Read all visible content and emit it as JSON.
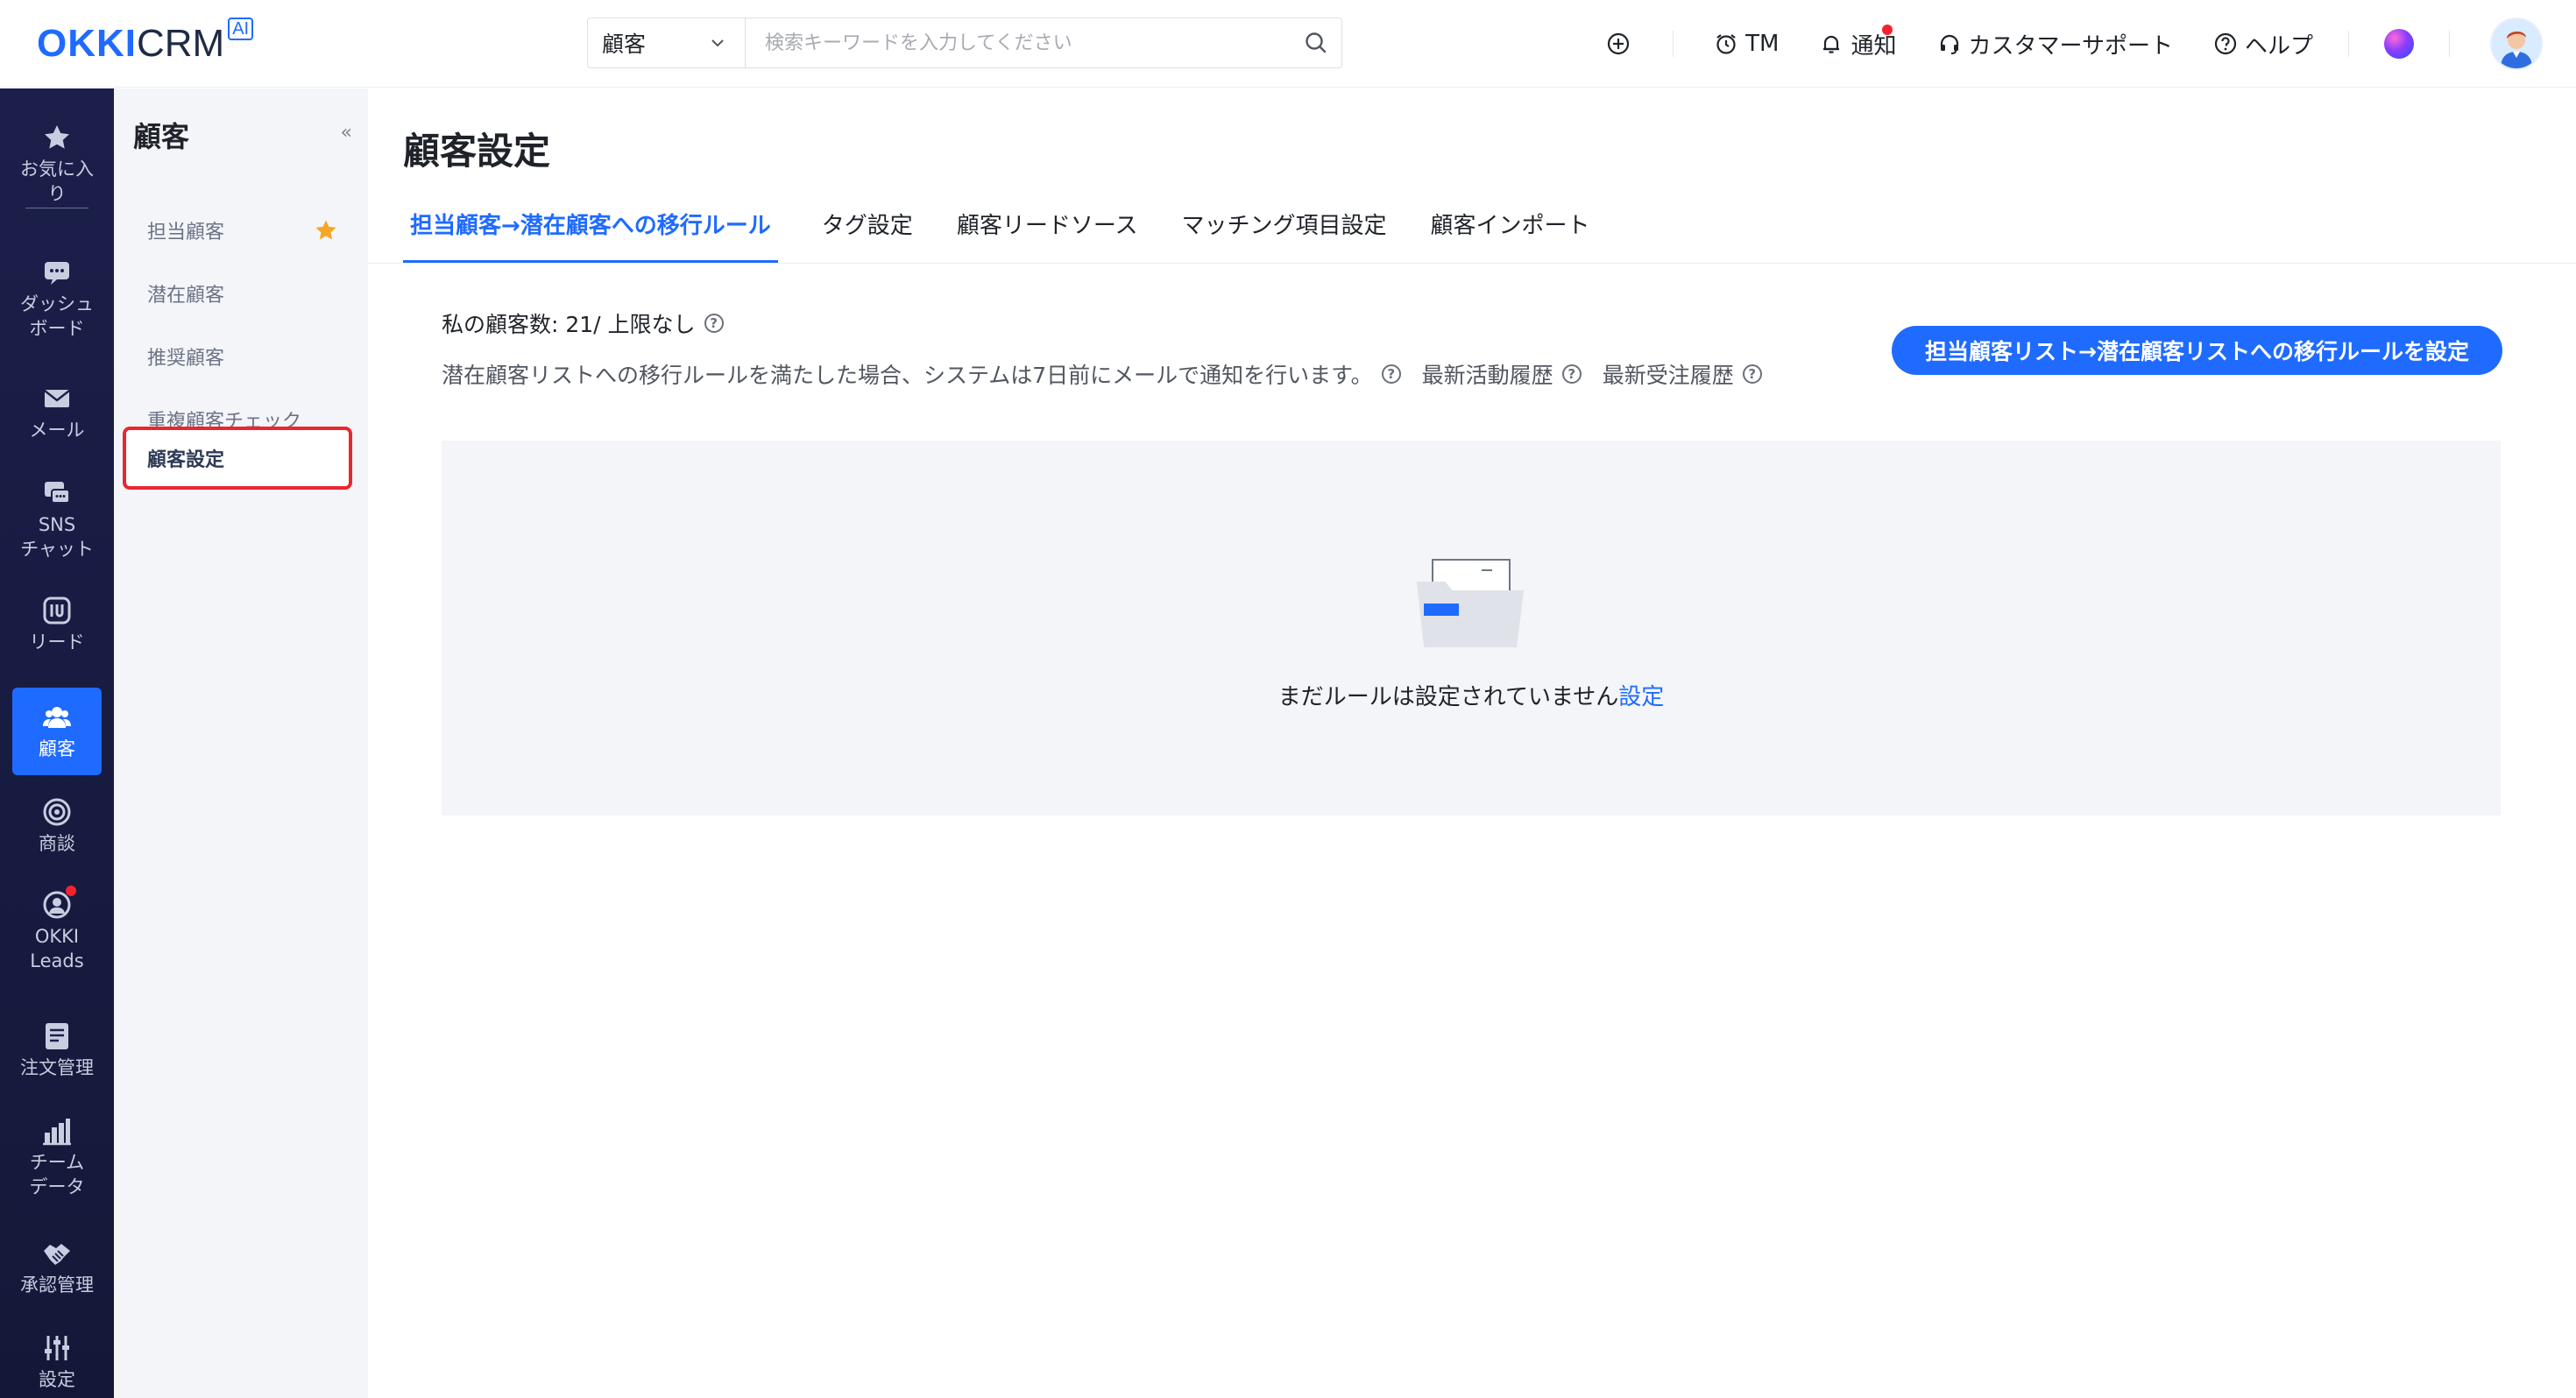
{
  "header": {
    "logo": {
      "brand_bold": "OKKI",
      "brand_light": "CRM",
      "badge": "AI"
    },
    "search": {
      "scope": "顧客",
      "placeholder": "検索キーワードを入力してください",
      "value": ""
    },
    "nav": {
      "tm": "TM",
      "notice": "通知",
      "support": "カスタマーサポート",
      "help": "ヘルプ"
    },
    "colors": {
      "brand": "#1f6bff",
      "alert_dot": "#f5222d"
    }
  },
  "rail": {
    "items": [
      {
        "label": "お気に入り",
        "icon": "star-icon"
      },
      {
        "label": "ダッシュボード",
        "icon": "dashboard-icon"
      },
      {
        "label": "メール",
        "icon": "mail-icon"
      },
      {
        "label": "SNSチャット",
        "icon": "chat-icon"
      },
      {
        "label": "リード",
        "icon": "leads-icon"
      },
      {
        "label": "顧客",
        "icon": "customer-icon",
        "active": true
      },
      {
        "label": "商談",
        "icon": "target-icon"
      },
      {
        "label": "OKKI Leads",
        "icon": "okki-leads-icon"
      },
      {
        "label": "注文管理",
        "icon": "order-icon"
      },
      {
        "label": "チームデータ",
        "icon": "bar-chart-icon"
      },
      {
        "label": "承認管理",
        "icon": "handshake-icon"
      },
      {
        "label": "設定",
        "icon": "settings-icon"
      }
    ],
    "text": {
      "fav_a": "お気に入",
      "fav_b": "り",
      "dash_a": "ダッシュ",
      "dash_b": "ボード",
      "mail": "メール",
      "sns_a": "SNS",
      "sns_b": "チャット",
      "lead": "リード",
      "customer": "顧客",
      "deal": "商談",
      "okki_a": "OKKI",
      "okki_b": "Leads",
      "order": "注文管理",
      "team_a": "チーム",
      "team_b": "データ",
      "approval": "承認管理",
      "settings": "設定"
    }
  },
  "subsidebar": {
    "title": "顧客",
    "collapse": "«",
    "items": [
      {
        "label": "担当顧客",
        "starred": true
      },
      {
        "label": "潜在顧客"
      },
      {
        "label": "推奨顧客"
      },
      {
        "label": "重複顧客チェック"
      },
      {
        "label": "顧客設定",
        "active": true
      }
    ]
  },
  "main": {
    "title": "顧客設定",
    "tabs": [
      {
        "label": "担当顧客→潜在顧客への移行ルール",
        "active": true
      },
      {
        "label": "タグ設定"
      },
      {
        "label": "顧客リードソース"
      },
      {
        "label": "マッチング項目設定"
      },
      {
        "label": "顧客インポート"
      }
    ],
    "my_customers_label": "私の顧客数: 21/ 上限なし",
    "rule_note": "潜在顧客リストへの移行ルールを満たした場合、システムは7日前にメールで通知を行います。",
    "latest_activity": "最新活動履歴",
    "latest_order": "最新受注履歴",
    "cta_button": "担当顧客リスト→潜在顧客リストへの移行ルールを設定",
    "empty_state": {
      "text": "まだルールは設定されていません",
      "link": "設定"
    }
  }
}
